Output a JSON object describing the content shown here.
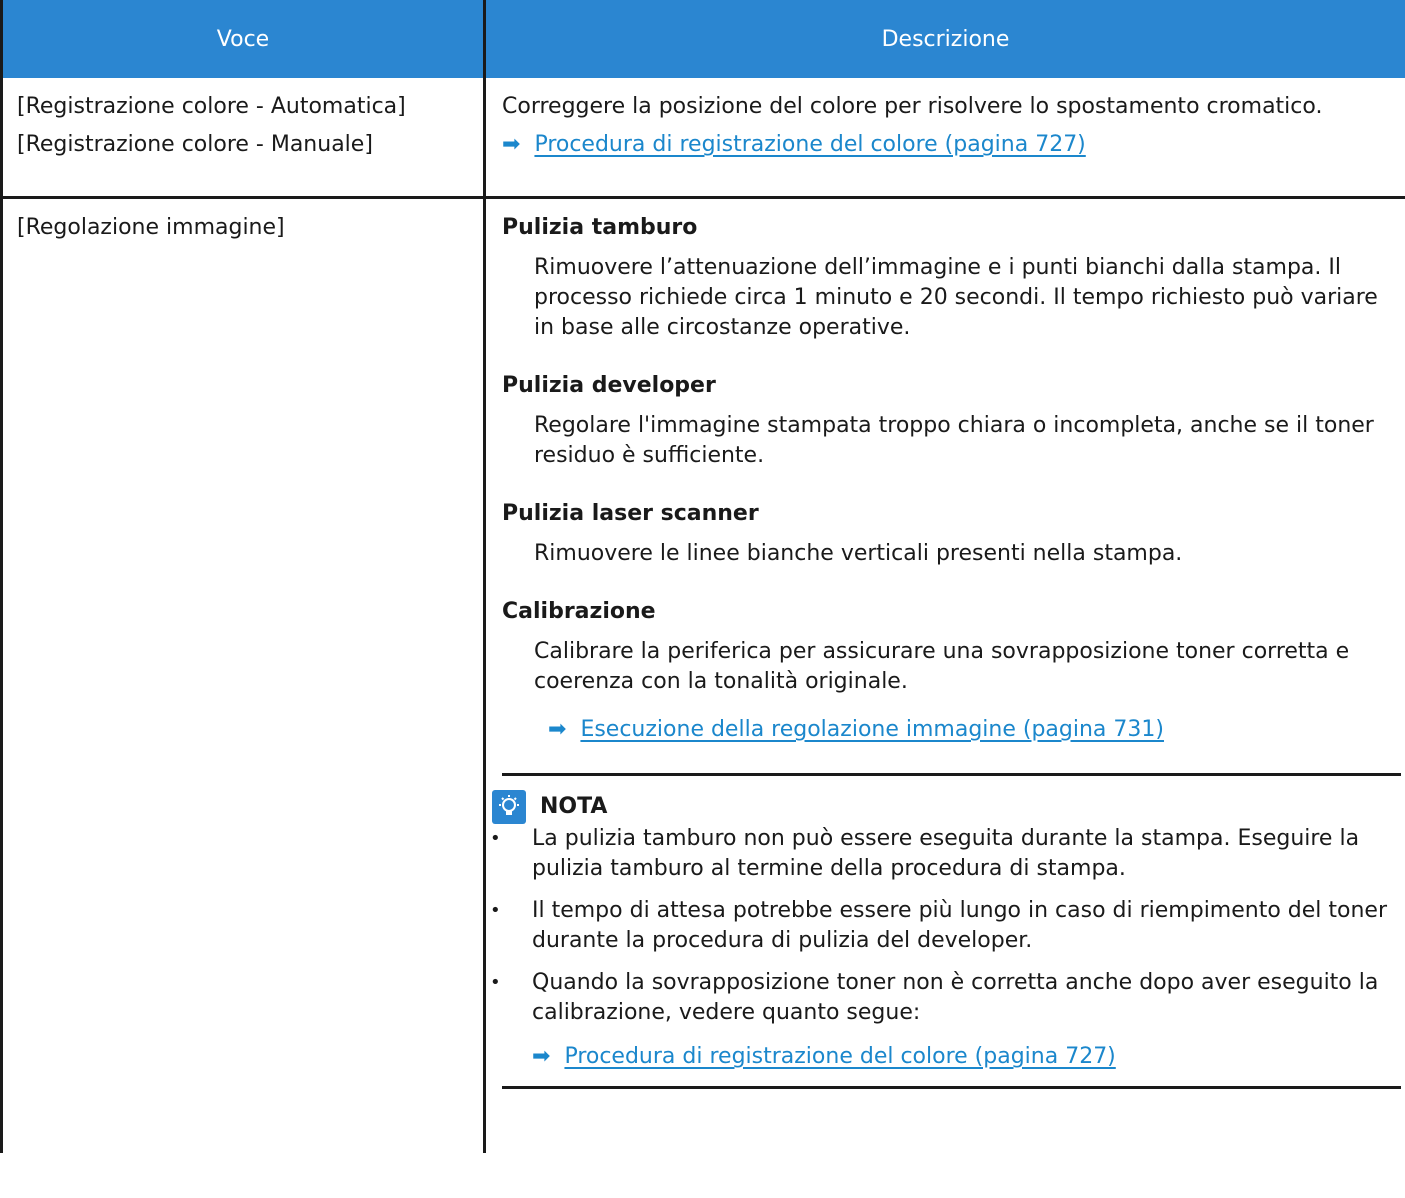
{
  "table": {
    "headers": {
      "item": "Voce",
      "description": "Descrizione"
    },
    "row1": {
      "items": [
        "[Registrazione colore - Automatica]",
        "[Registrazione colore - Manuale]"
      ],
      "description": "Correggere la posizione del colore per risolvere lo spostamento cromatico.",
      "link": "Procedura di registrazione del colore (pagina 727)"
    },
    "row2": {
      "item": "[Regolazione immagine]",
      "sections": [
        {
          "title": "Pulizia tamburo",
          "text": "Rimuovere l’attenuazione dell’immagine e i punti bianchi dalla stampa. Il processo richiede circa 1 minuto e 20 secondi. Il tempo richiesto può variare in base alle circostanze operative."
        },
        {
          "title": "Pulizia developer",
          "text": "Regolare l'immagine stampata troppo chiara o incompleta, anche se il toner residuo è sufficiente."
        },
        {
          "title": "Pulizia laser scanner",
          "text": "Rimuovere le linee bianche verticali presenti nella stampa."
        },
        {
          "title": "Calibrazione",
          "text": "Calibrare la periferica per assicurare una sovrapposizione toner corretta e coerenza con la tonalità originale."
        }
      ],
      "calibration_link": "Esecuzione della regolazione immagine (pagina 731)",
      "note": {
        "title": "NOTA",
        "bullets": [
          "La pulizia tamburo non può essere eseguita durante la stampa. Eseguire la pulizia tamburo al termine della procedura di stampa.",
          "Il tempo di attesa potrebbe essere più lungo in caso di riempimento del toner durante la procedura di pulizia del developer.",
          "Quando la sovrapposizione toner non è corretta anche dopo aver eseguito la calibrazione, vedere quanto segue:"
        ],
        "link": "Procedura di registrazione del colore (pagina 727)"
      }
    }
  },
  "colors": {
    "header_bg": "#2b86d1",
    "link": "#1b87cc",
    "border": "#1a1a1a"
  },
  "icons": {
    "arrow": "right-arrow-icon",
    "note": "lightbulb-icon"
  }
}
